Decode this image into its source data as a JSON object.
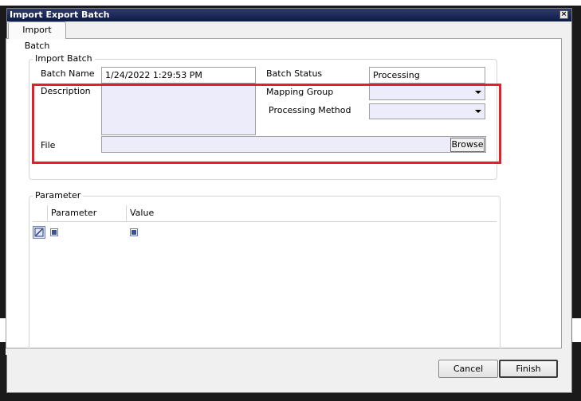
{
  "window": {
    "title": "Import Export Batch",
    "close_glyph": "×"
  },
  "tabs": [
    {
      "label": "Import Batch"
    }
  ],
  "import_batch": {
    "legend": "Import Batch",
    "batch_name_label": "Batch Name",
    "batch_name_value": "1/24/2022 1:29:53 PM",
    "batch_status_label": "Batch Status",
    "batch_status_value": "Processing",
    "description_label": "Description",
    "description_value": "",
    "mapping_group_label": "Mapping Group",
    "mapping_group_value": "",
    "processing_method_label": "Processing Method",
    "processing_method_value": "",
    "file_label": "File",
    "file_value": "",
    "browse_label": "Browse"
  },
  "parameter": {
    "legend": "Parameter",
    "columns": [
      "Parameter",
      "Value"
    ]
  },
  "footer": {
    "cancel_label": "Cancel",
    "finish_label": "Finish"
  },
  "colors": {
    "highlight": "#e0202a",
    "title_bar": "#0c1a4a",
    "field_fill": "#ececfa"
  },
  "icons": {
    "row_indicator": "pencil-edit-icon",
    "close": "close-icon",
    "dropdown": "chevron-down-icon"
  }
}
